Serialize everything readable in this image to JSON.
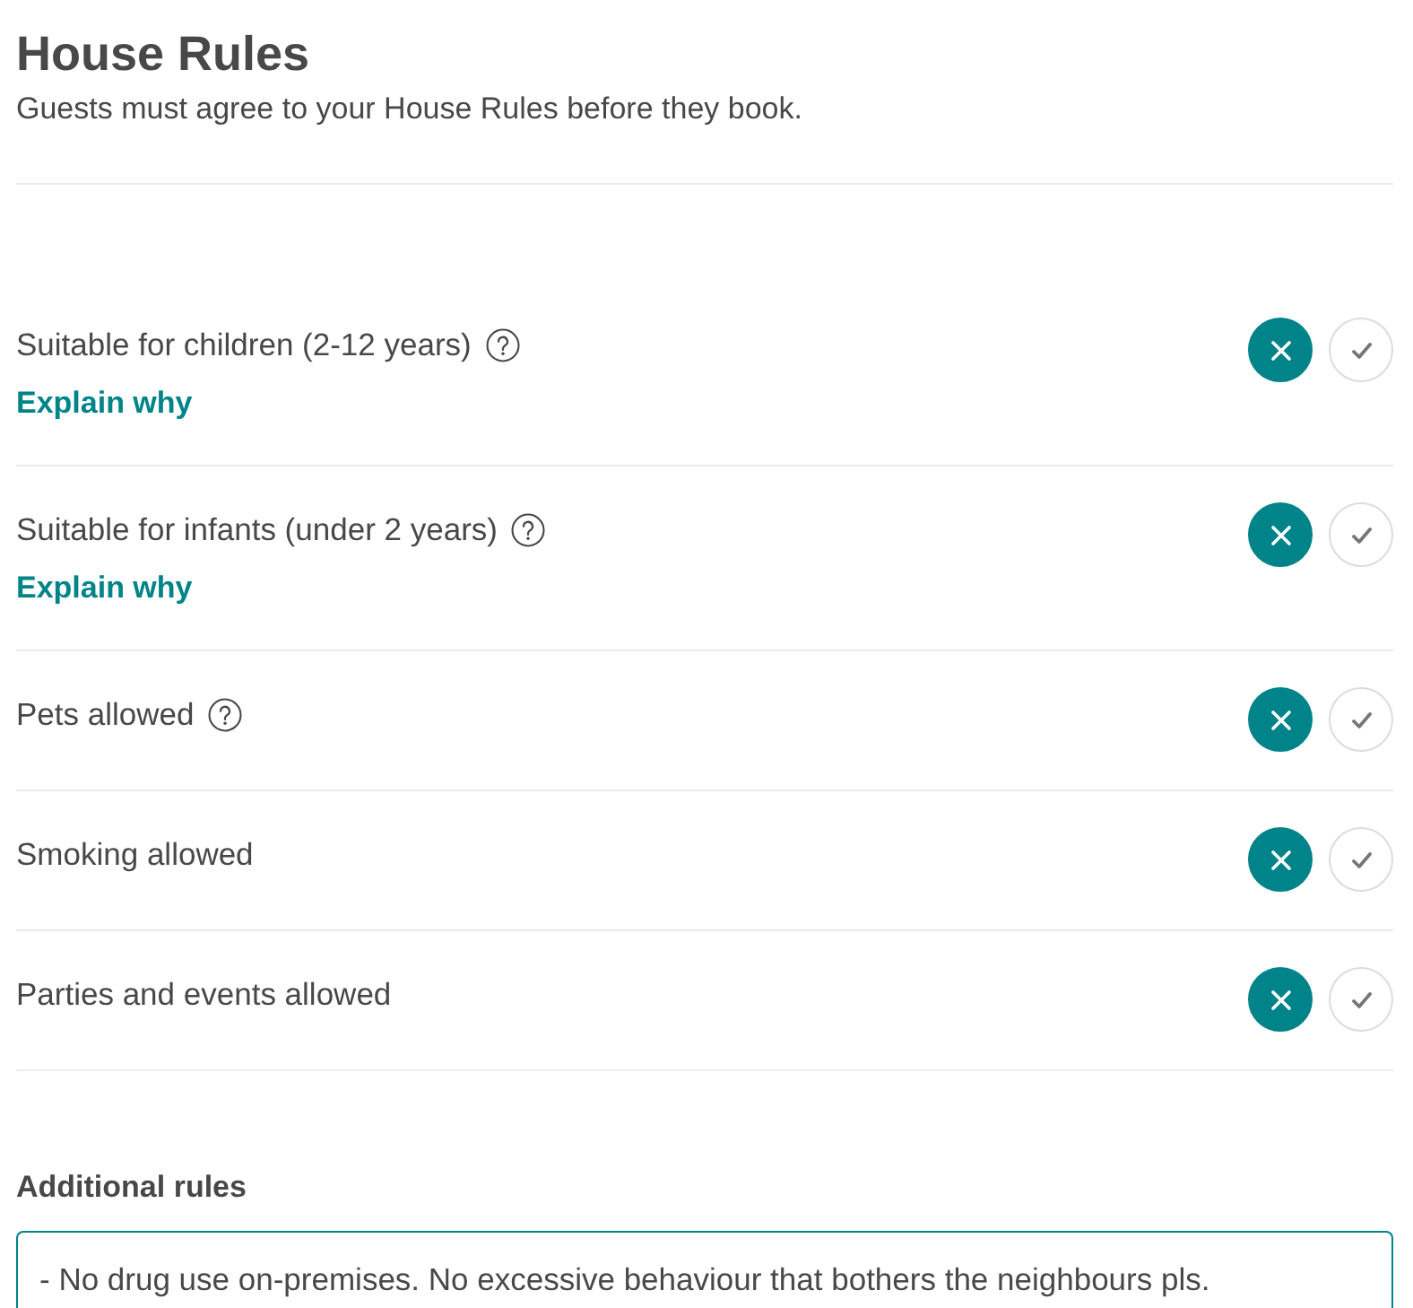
{
  "page": {
    "title": "House Rules",
    "subtitle": "Guests must agree to your House Rules before they book."
  },
  "rules": [
    {
      "label": "Suitable for children (2-12 years)",
      "help": true,
      "explain_link": "Explain why",
      "allowed": false
    },
    {
      "label": "Suitable for infants (under 2 years)",
      "help": true,
      "explain_link": "Explain why",
      "allowed": false
    },
    {
      "label": "Pets allowed",
      "help": true,
      "allowed": false
    },
    {
      "label": "Smoking allowed",
      "help": false,
      "allowed": false
    },
    {
      "label": "Parties and events allowed",
      "help": false,
      "allowed": false
    }
  ],
  "additional_rules": {
    "label": "Additional rules",
    "value": "- No drug use on-premises. No excessive behaviour that bothers the neighbours pls.",
    "focused": true
  }
}
